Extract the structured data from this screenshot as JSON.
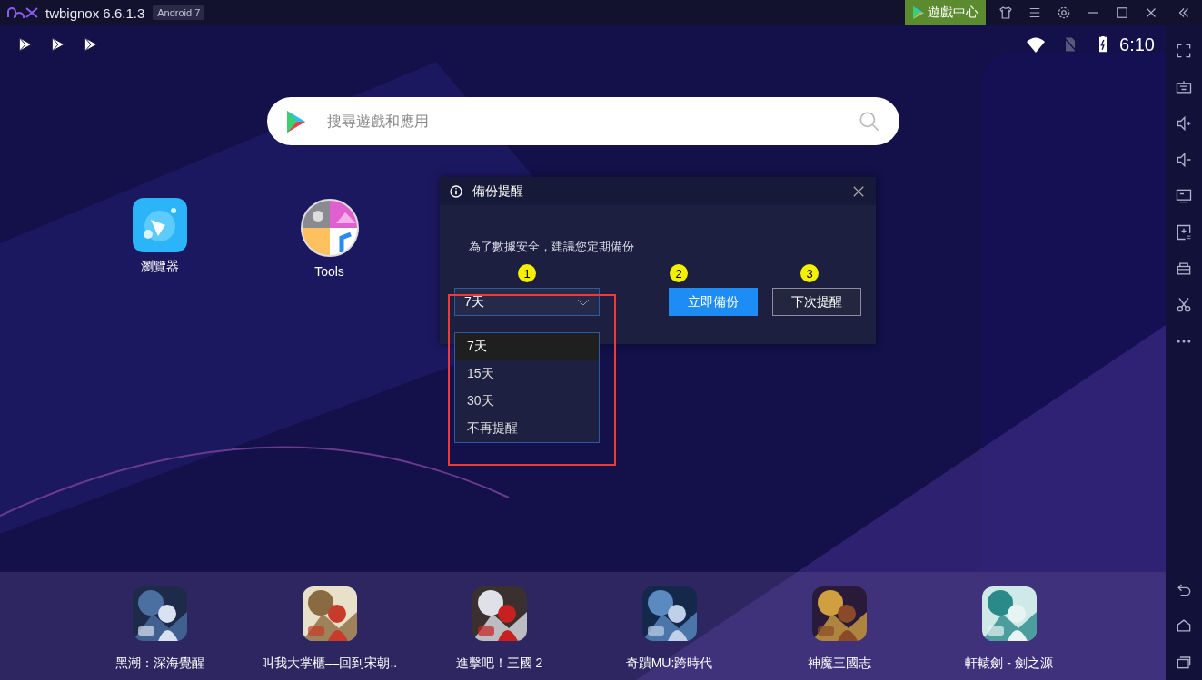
{
  "titlebar": {
    "app_name": "twbignox 6.6.1.3",
    "version_badge": "Android 7",
    "game_center_button": "遊戲中心"
  },
  "status_bar": {
    "time": "6:10"
  },
  "search": {
    "placeholder": "搜尋遊戲和應用"
  },
  "desktop_apps": [
    {
      "label": "瀏覽器",
      "kind": "browser"
    },
    {
      "label": "Tools",
      "kind": "tools"
    }
  ],
  "dialog": {
    "title": "備份提醒",
    "message": "為了數據安全，建議您定期備份",
    "select": {
      "value": "7天",
      "expanded": true,
      "marker": "1",
      "options": [
        {
          "label": "7天",
          "selected": true
        },
        {
          "label": "15天",
          "selected": false
        },
        {
          "label": "30天",
          "selected": false
        },
        {
          "label": "不再提醒",
          "selected": false
        }
      ]
    },
    "buttons": [
      {
        "label": "立即備份",
        "kind": "primary",
        "marker": "2"
      },
      {
        "label": "下次提醒",
        "kind": "secondary",
        "marker": "3"
      }
    ]
  },
  "dock": [
    {
      "label": "黑潮：深海覺醒",
      "kind": "picture"
    },
    {
      "label": "叫我大掌櫃––回到宋朝..",
      "kind": "picture"
    },
    {
      "label": "進擊吧！三國 2",
      "kind": "picture"
    },
    {
      "label": "奇蹟MU:跨時代",
      "kind": "picture"
    },
    {
      "label": "神魔三國志",
      "kind": "picture"
    },
    {
      "label": "軒轅劍 - 劍之源",
      "kind": "picture"
    }
  ]
}
